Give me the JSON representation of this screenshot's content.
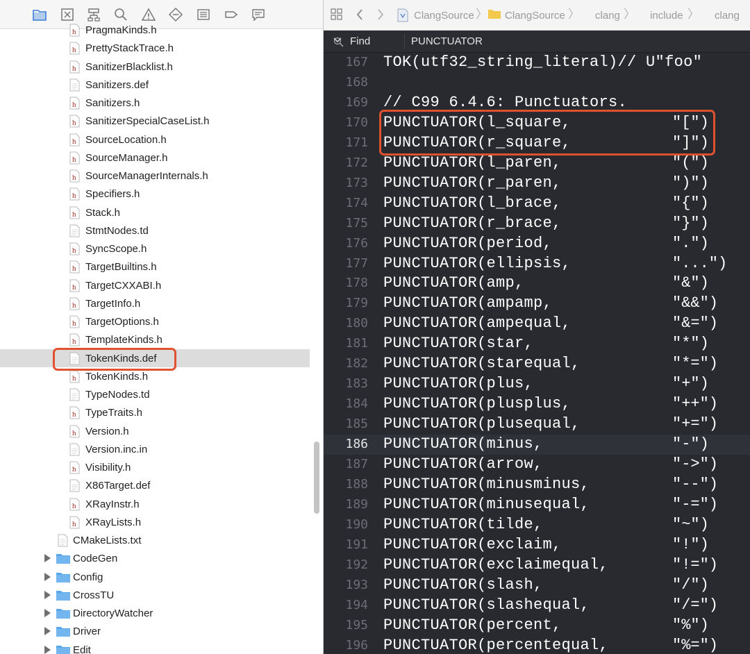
{
  "navigator": {
    "toolbar_icons": [
      "folder-icon",
      "source-control-icon",
      "hierarchy-icon",
      "search-icon",
      "warning-icon",
      "breakpoint-diamond-icon",
      "list-icon",
      "tag-icon",
      "comment-icon"
    ],
    "files": [
      {
        "name": "PragmaKinds.h",
        "type": "h"
      },
      {
        "name": "PrettyStackTrace.h",
        "type": "h"
      },
      {
        "name": "SanitizerBlacklist.h",
        "type": "h"
      },
      {
        "name": "Sanitizers.def",
        "type": "doc"
      },
      {
        "name": "Sanitizers.h",
        "type": "h"
      },
      {
        "name": "SanitizerSpecialCaseList.h",
        "type": "h"
      },
      {
        "name": "SourceLocation.h",
        "type": "h"
      },
      {
        "name": "SourceManager.h",
        "type": "h"
      },
      {
        "name": "SourceManagerInternals.h",
        "type": "h"
      },
      {
        "name": "Specifiers.h",
        "type": "h"
      },
      {
        "name": "Stack.h",
        "type": "h"
      },
      {
        "name": "StmtNodes.td",
        "type": "doc"
      },
      {
        "name": "SyncScope.h",
        "type": "h"
      },
      {
        "name": "TargetBuiltins.h",
        "type": "h"
      },
      {
        "name": "TargetCXXABI.h",
        "type": "h"
      },
      {
        "name": "TargetInfo.h",
        "type": "h"
      },
      {
        "name": "TargetOptions.h",
        "type": "h"
      },
      {
        "name": "TemplateKinds.h",
        "type": "h"
      },
      {
        "name": "TokenKinds.def",
        "type": "doc",
        "selected": true
      },
      {
        "name": "TokenKinds.h",
        "type": "h"
      },
      {
        "name": "TypeNodes.td",
        "type": "doc"
      },
      {
        "name": "TypeTraits.h",
        "type": "h"
      },
      {
        "name": "Version.h",
        "type": "h"
      },
      {
        "name": "Version.inc.in",
        "type": "doc"
      },
      {
        "name": "Visibility.h",
        "type": "h"
      },
      {
        "name": "X86Target.def",
        "type": "doc"
      },
      {
        "name": "XRayInstr.h",
        "type": "h"
      },
      {
        "name": "XRayLists.h",
        "type": "h"
      }
    ],
    "top_level": [
      {
        "name": "CMakeLists.txt",
        "type": "doc"
      },
      {
        "name": "CodeGen",
        "type": "folder"
      },
      {
        "name": "Config",
        "type": "folder"
      },
      {
        "name": "CrossTU",
        "type": "folder"
      },
      {
        "name": "DirectoryWatcher",
        "type": "folder"
      },
      {
        "name": "Driver",
        "type": "folder"
      },
      {
        "name": "Edit",
        "type": "folder"
      }
    ]
  },
  "jumpbar": {
    "items": [
      "ClangSource",
      "ClangSource",
      "clang",
      "include",
      "clang"
    ]
  },
  "find": {
    "mode": "Find",
    "query": "PUNCTUATOR"
  },
  "editor": {
    "current_line": 186,
    "lines": [
      {
        "n": "167",
        "code": "TOK(utf32_string_literal)// U\"foo\"",
        "lit": ""
      },
      {
        "n": "168",
        "code": "",
        "lit": ""
      },
      {
        "n": "169",
        "code": "// C99 6.4.6: Punctuators.",
        "lit": ""
      },
      {
        "n": "170",
        "code": "PUNCTUATOR(l_square,",
        "lit": "\"[\")"
      },
      {
        "n": "171",
        "code": "PUNCTUATOR(r_square,",
        "lit": "\"]\")"
      },
      {
        "n": "172",
        "code": "PUNCTUATOR(l_paren,",
        "lit": "\"(\")"
      },
      {
        "n": "173",
        "code": "PUNCTUATOR(r_paren,",
        "lit": "\")\")"
      },
      {
        "n": "174",
        "code": "PUNCTUATOR(l_brace,",
        "lit": "\"{\")"
      },
      {
        "n": "175",
        "code": "PUNCTUATOR(r_brace,",
        "lit": "\"}\")"
      },
      {
        "n": "176",
        "code": "PUNCTUATOR(period,",
        "lit": "\".\")"
      },
      {
        "n": "177",
        "code": "PUNCTUATOR(ellipsis,",
        "lit": "\"...\")"
      },
      {
        "n": "178",
        "code": "PUNCTUATOR(amp,",
        "lit": "\"&\")"
      },
      {
        "n": "179",
        "code": "PUNCTUATOR(ampamp,",
        "lit": "\"&&\")"
      },
      {
        "n": "180",
        "code": "PUNCTUATOR(ampequal,",
        "lit": "\"&=\")"
      },
      {
        "n": "181",
        "code": "PUNCTUATOR(star,",
        "lit": "\"*\")"
      },
      {
        "n": "182",
        "code": "PUNCTUATOR(starequal,",
        "lit": "\"*=\")"
      },
      {
        "n": "183",
        "code": "PUNCTUATOR(plus,",
        "lit": "\"+\")"
      },
      {
        "n": "184",
        "code": "PUNCTUATOR(plusplus,",
        "lit": "\"++\")"
      },
      {
        "n": "185",
        "code": "PUNCTUATOR(plusequal,",
        "lit": "\"+=\")"
      },
      {
        "n": "186",
        "code": "PUNCTUATOR(minus,",
        "lit": "\"-\")"
      },
      {
        "n": "187",
        "code": "PUNCTUATOR(arrow,",
        "lit": "\"->\")"
      },
      {
        "n": "188",
        "code": "PUNCTUATOR(minusminus,",
        "lit": "\"--\")"
      },
      {
        "n": "189",
        "code": "PUNCTUATOR(minusequal,",
        "lit": "\"-=\")"
      },
      {
        "n": "190",
        "code": "PUNCTUATOR(tilde,",
        "lit": "\"~\")"
      },
      {
        "n": "191",
        "code": "PUNCTUATOR(exclaim,",
        "lit": "\"!\")"
      },
      {
        "n": "192",
        "code": "PUNCTUATOR(exclaimequal,",
        "lit": "\"!=\")"
      },
      {
        "n": "193",
        "code": "PUNCTUATOR(slash,",
        "lit": "\"/\")"
      },
      {
        "n": "194",
        "code": "PUNCTUATOR(slashequal,",
        "lit": "\"/=\")"
      },
      {
        "n": "195",
        "code": "PUNCTUATOR(percent,",
        "lit": "\"%\")"
      },
      {
        "n": "196",
        "code": "PUNCTUATOR(percentequal,",
        "lit": "\"%=\")"
      }
    ]
  },
  "colors": {
    "highlight": "#e0522e",
    "editor_bg": "#292a30",
    "header_icon_red": "#9b2b22",
    "folder_blue": "#5aa7e8"
  }
}
